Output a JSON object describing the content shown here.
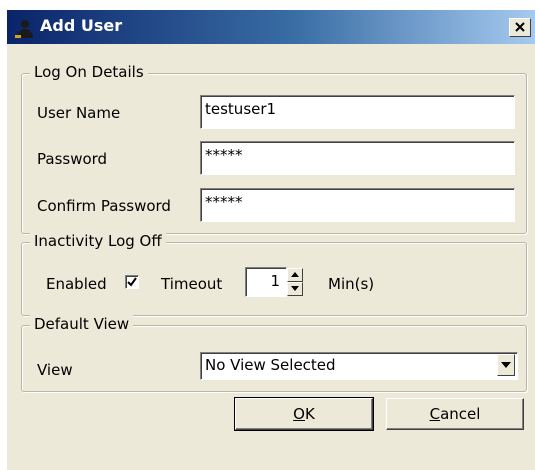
{
  "window": {
    "title": "Add User",
    "close_glyph": "×",
    "app_icon": "user-silhouette-icon"
  },
  "logon": {
    "legend": "Log On Details",
    "username_label": "User Name",
    "username_value": "testuser1",
    "password_label": "Password",
    "password_value": "*****",
    "confirm_label": "Confirm Password",
    "confirm_value": "*****"
  },
  "inactivity": {
    "legend": "Inactivity Log Off",
    "enabled_label": "Enabled",
    "enabled_checked": true,
    "timeout_label": "Timeout",
    "timeout_value": "1",
    "unit_label": "Min(s)"
  },
  "default_view": {
    "legend": "Default View",
    "view_label": "View",
    "view_value": "No View Selected"
  },
  "buttons": {
    "ok_accel": "O",
    "ok_rest": "K",
    "cancel_accel": "C",
    "cancel_rest": "ancel"
  }
}
